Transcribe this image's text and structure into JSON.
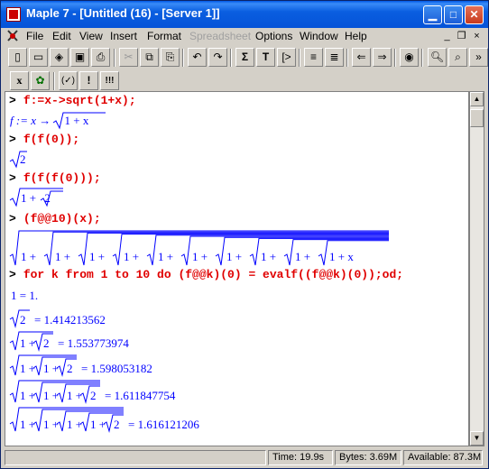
{
  "window": {
    "title": "Maple 7  - [Untitled (16) - [Server 1]]"
  },
  "menu": [
    "File",
    "Edit",
    "View",
    "Insert",
    "Format",
    "Spreadsheet",
    "Options",
    "Window",
    "Help"
  ],
  "toolbar2": {
    "x_label": "x",
    "check_label": "(✓)",
    "excl_label": "!",
    "excl3_label": "!!!"
  },
  "worksheet": {
    "prompt": ">",
    "cmd1": "f:=x->sqrt(1+x);",
    "out1": {
      "lhs": "f := x",
      "arrow": "→",
      "rad": "1 + x"
    },
    "cmd2": "f(f(0));",
    "out2": "2",
    "cmd3": "f(f(f(0)));",
    "out3": {
      "one_plus": "1 + ",
      "inner": "2"
    },
    "cmd4": "(f@@10)(x);",
    "out4": {
      "term": "1 +",
      "last": "1 + x"
    },
    "cmd5": "for k from 1 to 10 do (f@@k)(0) = evalf((f@@k)(0));od;",
    "results": [
      {
        "lhs": "1 = ",
        "value": "1."
      },
      {
        "value": "= 1.414213562"
      },
      {
        "value": "= 1.553773974"
      },
      {
        "value": "= 1.598053182"
      },
      {
        "value": "= 1.611847754"
      },
      {
        "value": "= 1.616121206"
      }
    ],
    "sqrt_arg": "2",
    "one_plus": "1 +"
  },
  "status": {
    "time": "Time: 19.9s",
    "bytes": "Bytes: 3.69M",
    "available": "Available: 87.3M"
  }
}
